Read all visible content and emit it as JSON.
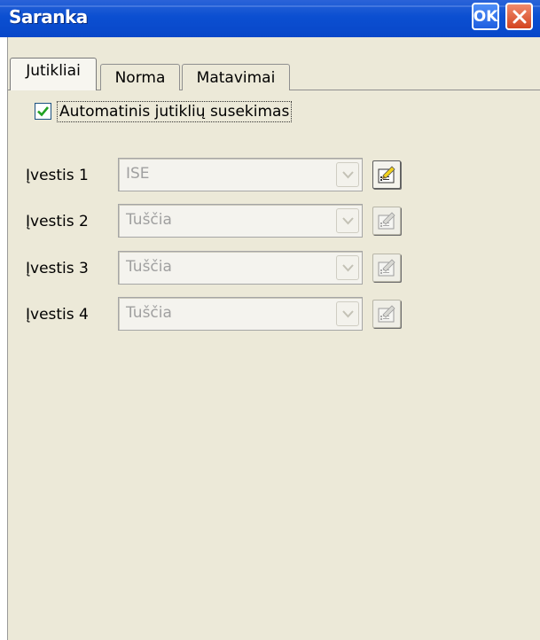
{
  "window": {
    "title": "Saranka",
    "ok_label": "OK"
  },
  "tabs": [
    {
      "label": "Jutikliai",
      "active": true
    },
    {
      "label": "Norma",
      "active": false
    },
    {
      "label": "Matavimai",
      "active": false
    }
  ],
  "auto_detect": {
    "label": "Automatinis jutiklių susekimas",
    "checked": true
  },
  "inputs": [
    {
      "label": "Įvestis 1",
      "value": "ISE",
      "icon": "edit-sensor-icon",
      "enabled": true
    },
    {
      "label": "Įvestis 2",
      "value": "Tuščia",
      "icon": "edit-sensor-icon",
      "enabled": false
    },
    {
      "label": "Įvestis 3",
      "value": "Tuščia",
      "icon": "edit-sensor-icon",
      "enabled": false
    },
    {
      "label": "Įvestis 4",
      "value": "Tuščia",
      "icon": "edit-sensor-icon",
      "enabled": false
    }
  ],
  "colors": {
    "titlebar": "#0b4fd1",
    "client_bg": "#ece9d8",
    "disabled_text": "#a0a0a0",
    "check_green": "#21a121"
  }
}
